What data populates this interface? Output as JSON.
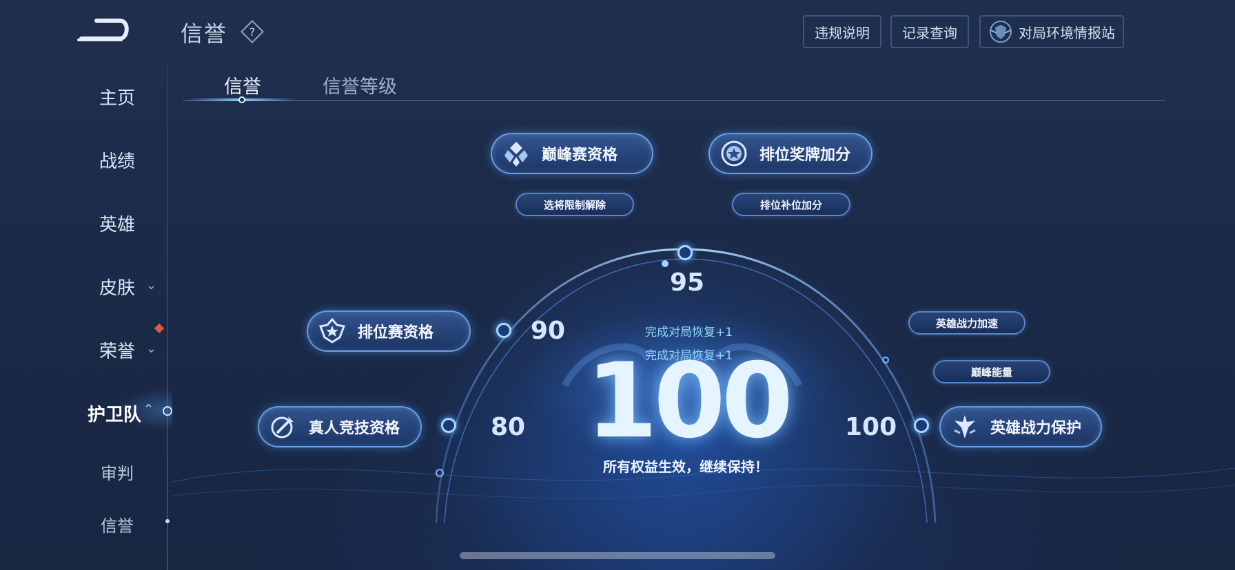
{
  "header": {
    "title": "信誉",
    "buttons": {
      "rules": "违规说明",
      "records": "记录查询",
      "environment": "对局环境情报站"
    }
  },
  "sidebar": {
    "items": [
      {
        "label": "主页"
      },
      {
        "label": "战绩"
      },
      {
        "label": "英雄"
      },
      {
        "label": "皮肤"
      },
      {
        "label": "荣誉"
      },
      {
        "label": "护卫队"
      },
      {
        "label": "审判"
      },
      {
        "label": "信誉"
      }
    ]
  },
  "tabs": [
    {
      "label": "信誉"
    },
    {
      "label": "信誉等级"
    }
  ],
  "benefits": {
    "peak": "巅峰赛资格",
    "rank_medal": "排位奖牌加分",
    "pick_unlock": "选将限制解除",
    "rank_fill": "排位补位加分",
    "ranked": "排位赛资格",
    "real_match": "真人竞技资格",
    "hero_speed": "英雄战力加速",
    "peak_energy": "巅峰能量",
    "hero_protect": "英雄战力保护"
  },
  "thresholds": {
    "t95": "95",
    "t90": "90",
    "t80": "80",
    "t100": "100"
  },
  "recovery": [
    "完成对局恢复+1",
    "完成对局恢复+1"
  ],
  "score": {
    "value": "100",
    "status": "所有权益生效，继续保持！"
  },
  "colors": {
    "background": "#1c2b48",
    "accent": "#8cc7ff",
    "badge": "#e05a3d"
  }
}
